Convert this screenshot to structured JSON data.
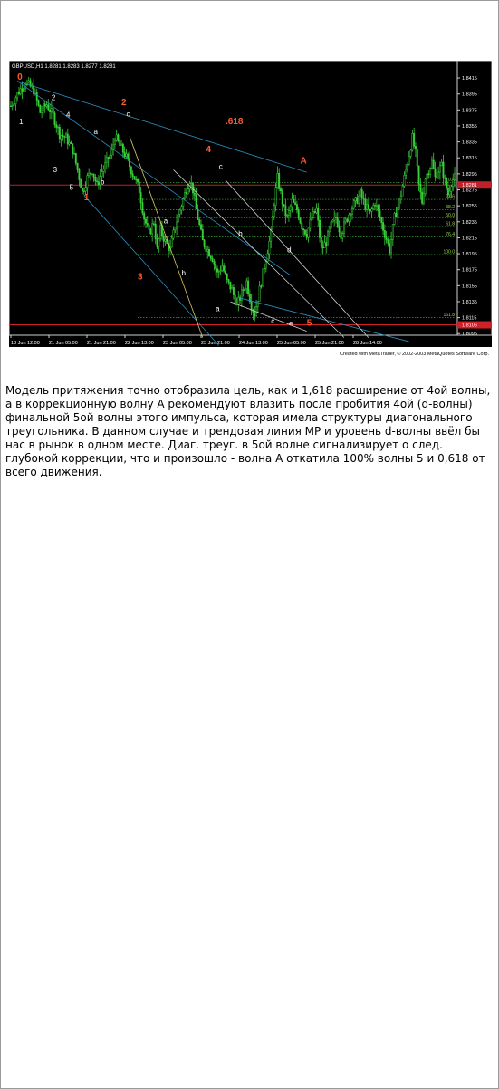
{
  "page": {
    "caption": "Модель притяжения точно отобразила цель, как и 1,618 расширение от 4ой волны, а в коррекционную волну А рекомендуют влазить после пробития 4ой (d-волны) финальной 5ой волны этого импульса, которая имела структуры диагонального треугольника. В данном случае и трендовая линия МР и уровень d-волны ввёл бы нас в рынок в одном месте. Диаг. треуг. в 5ой волне сигнализирует о след. глубокой коррекции, что и произошло - волна А откатила 100% волны 5 и 0,618 от всего движения."
  },
  "chart_data": {
    "type": "candlestick",
    "title": "GBPUSD,H1  1.8281 1.8283 1.8277 1.8281",
    "footer": "Created with MetaTrader, © 2002-2003 MetaQuotes Software Corp.",
    "x_labels": [
      "18 Jun 12:00",
      "21 Jun 05:00",
      "21 Jun 21:00",
      "22 Jun 13:00",
      "23 Jun 05:00",
      "23 Jun 21:00",
      "24 Jun 13:00",
      "25 Jun 05:00",
      "25 Jun 21:00",
      "28 Jun 14:00"
    ],
    "y_labels": [
      "1.8415",
      "1.8395",
      "1.8375",
      "1.8355",
      "1.8335",
      "1.8315",
      "1.8295",
      "1.8281",
      "1.8275",
      "1.8255",
      "1.8235",
      "1.8215",
      "1.8195",
      "1.8175",
      "1.8155",
      "1.8135",
      "1.8115",
      "1.8095"
    ],
    "ylim": [
      1.8093,
      1.8423
    ],
    "current_price": "1.8281",
    "red_level_price": "1.8106",
    "fib_levels": [
      {
        "label": "0.0",
        "price": 1.8284
      },
      {
        "label": "23.6",
        "price": 1.8263
      },
      {
        "label": "38.2",
        "price": 1.825
      },
      {
        "label": "50.0",
        "price": 1.824
      },
      {
        "label": "61.8",
        "price": 1.8229
      },
      {
        "label": "76.4",
        "price": 1.8216
      },
      {
        "label": "100.0",
        "price": 1.8194
      },
      {
        "label": "161.8",
        "price": 1.8115
      }
    ],
    "close_path": [
      [
        0,
        1.838
      ],
      [
        4,
        1.8395
      ],
      [
        9,
        1.841
      ],
      [
        14,
        1.84
      ],
      [
        18,
        1.8372
      ],
      [
        22,
        1.8382
      ],
      [
        26,
        1.8368
      ],
      [
        30,
        1.8345
      ],
      [
        34,
        1.834
      ],
      [
        38,
        1.8325
      ],
      [
        41,
        1.83
      ],
      [
        44,
        1.8272
      ],
      [
        47,
        1.829
      ],
      [
        50,
        1.83
      ],
      [
        53,
        1.828
      ],
      [
        56,
        1.8298
      ],
      [
        59,
        1.831
      ],
      [
        62,
        1.8322
      ],
      [
        64,
        1.8342
      ],
      [
        67,
        1.833
      ],
      [
        70,
        1.832
      ],
      [
        73,
        1.8305
      ],
      [
        76,
        1.829
      ],
      [
        79,
        1.8275
      ],
      [
        82,
        1.824
      ],
      [
        85,
        1.822
      ],
      [
        88,
        1.8235
      ],
      [
        90,
        1.82
      ],
      [
        92,
        1.8225
      ],
      [
        95,
        1.821
      ],
      [
        98,
        1.82
      ],
      [
        101,
        1.823
      ],
      [
        104,
        1.825
      ],
      [
        107,
        1.827
      ],
      [
        110,
        1.8288
      ],
      [
        112,
        1.8275
      ],
      [
        114,
        1.825
      ],
      [
        116,
        1.823
      ],
      [
        118,
        1.821
      ],
      [
        121,
        1.82
      ],
      [
        124,
        1.819
      ],
      [
        127,
        1.817
      ],
      [
        130,
        1.818
      ],
      [
        133,
        1.816
      ],
      [
        136,
        1.815
      ],
      [
        139,
        1.813
      ],
      [
        142,
        1.8145
      ],
      [
        145,
        1.816
      ],
      [
        148,
        1.813
      ],
      [
        150,
        1.812
      ],
      [
        152,
        1.814
      ],
      [
        154,
        1.816
      ],
      [
        156,
        1.818
      ],
      [
        158,
        1.82
      ],
      [
        160,
        1.822
      ],
      [
        162,
        1.826
      ],
      [
        164,
        1.829
      ],
      [
        166,
        1.827
      ],
      [
        168,
        1.825
      ],
      [
        170,
        1.824
      ],
      [
        173,
        1.826
      ],
      [
        176,
        1.825
      ],
      [
        179,
        1.823
      ],
      [
        182,
        1.822
      ],
      [
        185,
        1.824
      ],
      [
        188,
        1.825
      ],
      [
        191,
        1.82
      ],
      [
        194,
        1.821
      ],
      [
        197,
        1.823
      ],
      [
        200,
        1.824
      ],
      [
        203,
        1.822
      ],
      [
        206,
        1.8235
      ],
      [
        209,
        1.825
      ],
      [
        212,
        1.826
      ],
      [
        215,
        1.827
      ],
      [
        218,
        1.8255
      ],
      [
        221,
        1.8245
      ],
      [
        224,
        1.826
      ],
      [
        227,
        1.824
      ],
      [
        230,
        1.822
      ],
      [
        233,
        1.82
      ],
      [
        236,
        1.824
      ],
      [
        239,
        1.826
      ],
      [
        242,
        1.829
      ],
      [
        245,
        1.832
      ],
      [
        247,
        1.834
      ],
      [
        249,
        1.832
      ],
      [
        251,
        1.828
      ],
      [
        253,
        1.826
      ],
      [
        255,
        1.829
      ],
      [
        257,
        1.83
      ],
      [
        259,
        1.831
      ],
      [
        261,
        1.829
      ],
      [
        263,
        1.83
      ],
      [
        265,
        1.8305
      ],
      [
        267,
        1.8285
      ],
      [
        269,
        1.827
      ],
      [
        271,
        1.8285
      ],
      [
        273,
        1.829
      ]
    ],
    "wave_labels": [
      {
        "text": "0",
        "x": 4,
        "p": 1.8413,
        "color": "#ff5a2a",
        "size": 10
      },
      {
        "text": "1",
        "x": 5,
        "p": 1.8357,
        "color": "#ffffff",
        "size": 8
      },
      {
        "text": "2",
        "x": 25,
        "p": 1.8387,
        "color": "#ffffff",
        "size": 8
      },
      {
        "text": "4",
        "x": 34,
        "p": 1.8366,
        "color": "#ffffff",
        "size": 8
      },
      {
        "text": "a",
        "x": 51,
        "p": 1.8345,
        "color": "#ffffff",
        "size": 8
      },
      {
        "text": "2",
        "x": 68,
        "p": 1.8381,
        "color": "#ff5a2a",
        "size": 10
      },
      {
        "text": "c",
        "x": 71,
        "p": 1.8367,
        "color": "#ffffff",
        "size": 8
      },
      {
        "text": ".618",
        "x": 132,
        "p": 1.8357,
        "color": "#ff5a2a",
        "size": 10
      },
      {
        "text": "4",
        "x": 120,
        "p": 1.8322,
        "color": "#ff5a2a",
        "size": 10
      },
      {
        "text": "c",
        "x": 128,
        "p": 1.8301,
        "color": "#ffffff",
        "size": 8
      },
      {
        "text": "A",
        "x": 178,
        "p": 1.8308,
        "color": "#ff5a2a",
        "size": 10
      },
      {
        "text": "3",
        "x": 26,
        "p": 1.8297,
        "color": "#ffffff",
        "size": 8
      },
      {
        "text": "5",
        "x": 36,
        "p": 1.8275,
        "color": "#ffffff",
        "size": 8
      },
      {
        "text": "b",
        "x": 55,
        "p": 1.8282,
        "color": "#ffffff",
        "size": 8
      },
      {
        "text": "1",
        "x": 45,
        "p": 1.8262,
        "color": "#ff5a2a",
        "size": 10
      },
      {
        "text": "a",
        "x": 94,
        "p": 1.8233,
        "color": "#ffffff",
        "size": 8
      },
      {
        "text": "b",
        "x": 140,
        "p": 1.8217,
        "color": "#ffffff",
        "size": 8
      },
      {
        "text": "d",
        "x": 170,
        "p": 1.8197,
        "color": "#ffffff",
        "size": 8
      },
      {
        "text": "b",
        "x": 105,
        "p": 1.8168,
        "color": "#ffffff",
        "size": 8
      },
      {
        "text": "3",
        "x": 78,
        "p": 1.8163,
        "color": "#ff5a2a",
        "size": 10
      },
      {
        "text": "a",
        "x": 126,
        "p": 1.8123,
        "color": "#ffffff",
        "size": 8
      },
      {
        "text": "c",
        "x": 160,
        "p": 1.8108,
        "color": "#ffffff",
        "size": 8
      },
      {
        "text": "e",
        "x": 171,
        "p": 1.8105,
        "color": "#ffffff",
        "size": 8
      },
      {
        "text": "5",
        "x": 182,
        "p": 1.8105,
        "color": "#ff5a2a",
        "size": 10
      }
    ],
    "trend_lines": [
      {
        "color": "#2a8fbf",
        "pts": [
          [
            4,
            1.8411
          ],
          [
            182,
            1.8297
          ]
        ]
      },
      {
        "color": "#2a8fbf",
        "pts": [
          [
            4,
            1.8411
          ],
          [
            172,
            1.8168
          ]
        ]
      },
      {
        "color": "#2a8fbf",
        "pts": [
          [
            45,
            1.8268
          ],
          [
            128,
            1.808
          ]
        ]
      },
      {
        "color": "#2a8fbf",
        "pts": [
          [
            140,
            1.814
          ],
          [
            245,
            1.8085
          ]
        ]
      },
      {
        "color": "#d7c86a",
        "pts": [
          [
            73,
            1.8342
          ],
          [
            118,
            1.809
          ]
        ]
      },
      {
        "color": "#cfcfcf",
        "pts": [
          [
            132,
            1.8287
          ],
          [
            220,
            1.809
          ]
        ]
      },
      {
        "color": "#cfcfcf",
        "pts": [
          [
            100,
            1.83
          ],
          [
            205,
            1.809
          ]
        ]
      },
      {
        "color": "#cfcfcf",
        "pts": [
          [
            135,
            1.8135
          ],
          [
            182,
            1.8098
          ]
        ]
      }
    ]
  }
}
